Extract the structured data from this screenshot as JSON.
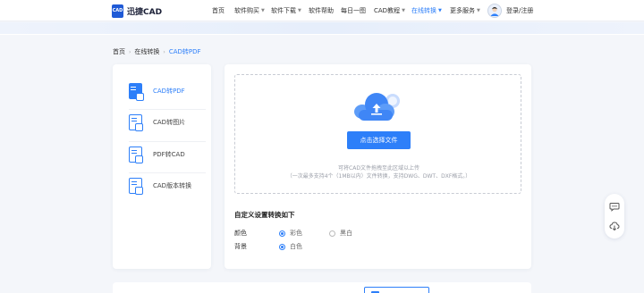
{
  "header": {
    "logo_badge": "CAD",
    "logo_text": "迅捷CAD",
    "nav": [
      {
        "label": "首页",
        "dropdown": false,
        "active": false
      },
      {
        "label": "软件购买",
        "dropdown": true,
        "active": false
      },
      {
        "label": "软件下载",
        "dropdown": true,
        "active": false
      },
      {
        "label": "软件帮助",
        "dropdown": false,
        "active": false
      },
      {
        "label": "每日一图",
        "dropdown": false,
        "active": false
      },
      {
        "label": "CAD教程",
        "dropdown": true,
        "active": false
      },
      {
        "label": "在线转换",
        "dropdown": true,
        "active": true
      },
      {
        "label": "更多服务",
        "dropdown": true,
        "active": false
      }
    ],
    "login": "登录/注册"
  },
  "breadcrumb": {
    "home": "首页",
    "section": "在线转换",
    "current": "CAD转PDF"
  },
  "sidebar": {
    "items": [
      {
        "label": "CAD转PDF",
        "active": true,
        "icon": "cad-to-pdf-icon"
      },
      {
        "label": "CAD转图片",
        "active": false,
        "icon": "cad-to-image-icon"
      },
      {
        "label": "PDF转CAD",
        "active": false,
        "icon": "pdf-to-cad-icon"
      },
      {
        "label": "CAD版本转换",
        "active": false,
        "icon": "cad-version-convert-icon"
      }
    ]
  },
  "upload": {
    "button_label": "点击选择文件",
    "hint_line1": "可将CAD文件拖拽至此区域以上传",
    "hint_line2": "（一次最多支持4个（1MB以内）文件转换，支持DWG、DWT、DXF格式。）"
  },
  "settings": {
    "title": "自定义设置转换如下",
    "color_label": "颜色",
    "color_options": [
      {
        "label": "彩色",
        "checked": true
      },
      {
        "label": "黑白",
        "checked": false
      }
    ],
    "background_label": "背景",
    "background_options": [
      {
        "label": "白色",
        "checked": true
      }
    ]
  },
  "colors": {
    "accent": "#2d7ff9",
    "page_bg": "#f4f6fa"
  }
}
